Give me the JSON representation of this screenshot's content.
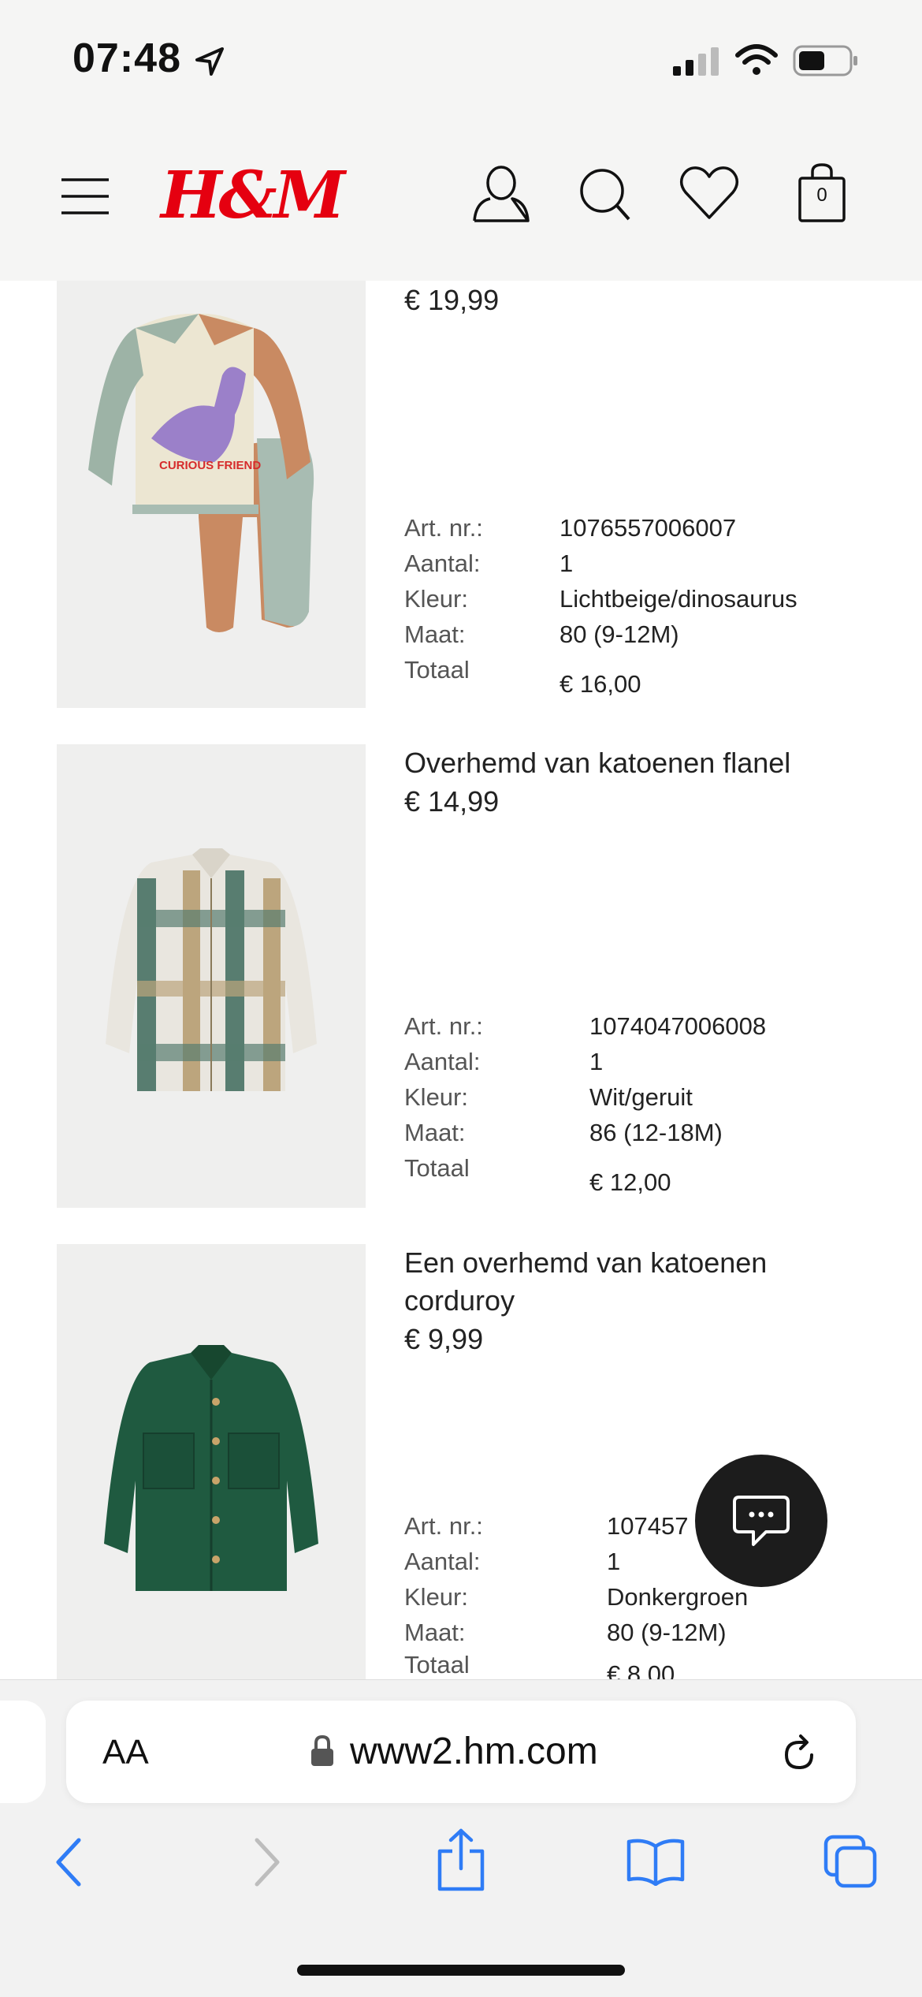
{
  "status_bar": {
    "time": "07:48"
  },
  "header": {
    "brand": "H&M",
    "cart_count": "0"
  },
  "products": [
    {
      "name": "",
      "price": "€ 19,99",
      "details": [
        {
          "label": "Art. nr.:",
          "value": "1076557006007"
        },
        {
          "label": "Aantal:",
          "value": "1"
        },
        {
          "label": "Kleur:",
          "value": "Lichtbeige/dinosaurus"
        },
        {
          "label": "Maat:",
          "value": "80 (9-12M)"
        },
        {
          "label": "Totaal",
          "value": "€ 16,00"
        }
      ],
      "image_text": "CURIOUS FRIEND"
    },
    {
      "name": "Overhemd van katoenen flanel",
      "price": "€ 14,99",
      "details": [
        {
          "label": "Art. nr.:",
          "value": "1074047006008"
        },
        {
          "label": "Aantal:",
          "value": "1"
        },
        {
          "label": "Kleur:",
          "value": "Wit/geruit"
        },
        {
          "label": "Maat:",
          "value": "86 (12-18M)"
        },
        {
          "label": "Totaal",
          "value": "€ 12,00"
        }
      ]
    },
    {
      "name": "Een overhemd van katoenen corduroy",
      "price": "€ 9,99",
      "details": [
        {
          "label": "Art. nr.:",
          "value": "107457"
        },
        {
          "label": "Aantal:",
          "value": "1"
        },
        {
          "label": "Kleur:",
          "value": "Donkergroen"
        },
        {
          "label": "Maat:",
          "value": "80 (9-12M)"
        },
        {
          "label": "Totaal",
          "value": "€ 8,00"
        }
      ]
    }
  ],
  "browser": {
    "text_size_label": "AA",
    "url": "www2.hm.com"
  },
  "colors": {
    "brand_red": "#e50010",
    "ios_blue": "#2f7cf6",
    "header_bg": "#f5f5f4"
  }
}
